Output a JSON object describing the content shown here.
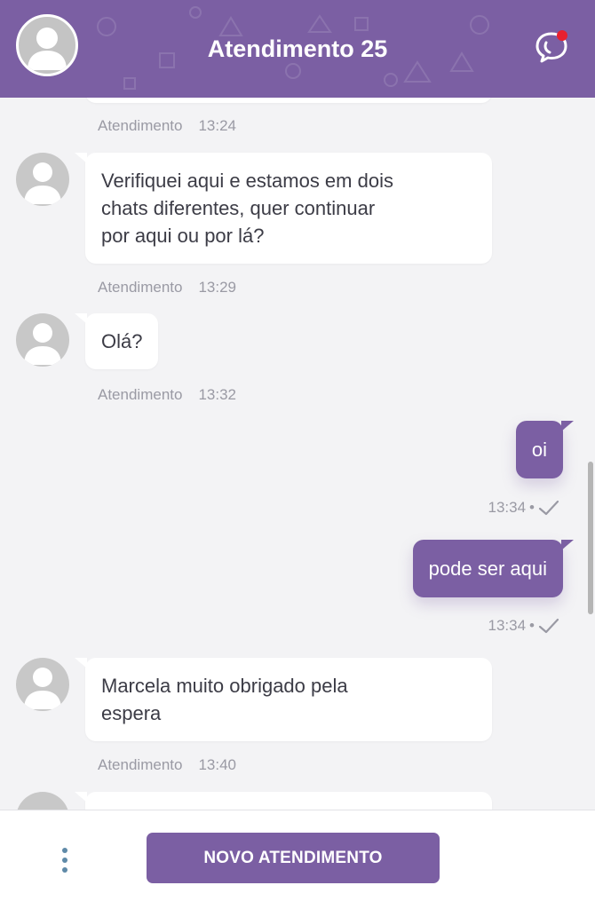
{
  "header": {
    "title": "Atendimento 25",
    "action_icon": "chat-notification-icon"
  },
  "colors": {
    "brand": "#7b5fa3",
    "notification": "#e8202e",
    "background": "#f3f3f5"
  },
  "messages": [
    {
      "direction": "in",
      "sender": "Atendimento",
      "time": "13:24",
      "text": ""
    },
    {
      "direction": "in",
      "sender": "Atendimento",
      "time": "13:29",
      "lines": [
        "Verifiquei aqui e estamos em dois",
        "chats diferentes, quer continuar",
        "por aqui ou por lá?"
      ]
    },
    {
      "direction": "in",
      "sender": "Atendimento",
      "time": "13:32",
      "lines": [
        "Olá?"
      ]
    },
    {
      "direction": "out",
      "time": "13:34",
      "separator": "•",
      "lines": [
        "oi"
      ],
      "status_icon": "check-icon"
    },
    {
      "direction": "out",
      "time": "13:34",
      "separator": "•",
      "lines": [
        "pode ser aqui"
      ],
      "status_icon": "check-icon"
    },
    {
      "direction": "in",
      "sender": "Atendimento",
      "time": "13:40",
      "lines": [
        "Marcela muito obrigado pela",
        "espera"
      ]
    }
  ],
  "footer": {
    "menu_icon": "more-vertical-icon",
    "new_button_label": "NOVO ATENDIMENTO"
  }
}
